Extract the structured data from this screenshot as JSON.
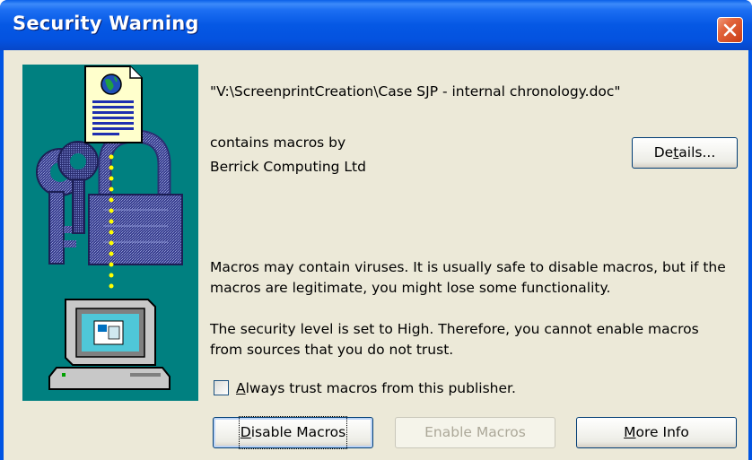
{
  "window": {
    "title": "Security Warning",
    "close_icon": "close-icon",
    "colors": {
      "titlebar": "#0558e4",
      "client": "#ece9d8",
      "panel": "#008080",
      "close": "#e2643c"
    }
  },
  "dialog": {
    "file_path": "\"V:\\ScreenprintCreation\\Case SJP - internal chronology.doc\"",
    "contains_line": "contains macros by",
    "publisher": "Berrick Computing Ltd",
    "details_button": {
      "pre": "De",
      "key": "t",
      "post": "ails..."
    },
    "warning_line1": "Macros may contain viruses. It is usually safe to disable macros, but if the",
    "warning_line2": "macros are legitimate, you might lose some functionality.",
    "security_line1": "The security level is set to High.  Therefore, you cannot enable macros",
    "security_line2": "from sources that you do not trust.",
    "trust_checkbox": {
      "key": "A",
      "rest": "lways trust macros from this publisher.",
      "checked": false
    },
    "buttons": {
      "disable": {
        "key": "D",
        "rest": "isable Macros"
      },
      "enable": {
        "label": "Enable Macros",
        "enabled": false
      },
      "more_info": {
        "pre": "",
        "key": "M",
        "post": "ore Info"
      }
    },
    "illustration_icons": [
      "document-globe-icon",
      "padlock-icon",
      "keys-icon",
      "computer-icon"
    ]
  }
}
